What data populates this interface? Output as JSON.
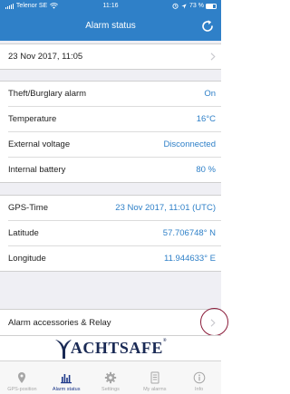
{
  "status_bar": {
    "carrier": "Telenor SE",
    "time": "11:16",
    "battery": "73 %",
    "battery_level": 0.73
  },
  "nav": {
    "title": "Alarm status",
    "refresh_icon": "refresh-icon"
  },
  "timestamp_row": {
    "label": "23 Nov 2017, 11:05",
    "chevron": "chevron-right-icon"
  },
  "status_rows": [
    {
      "label": "Theft/Burglary alarm",
      "value": "On"
    },
    {
      "label": "Temperature",
      "value": "16°C"
    },
    {
      "label": "External voltage",
      "value": "Disconnected"
    },
    {
      "label": "Internal battery",
      "value": "80 %"
    }
  ],
  "gps_rows": [
    {
      "label": "GPS-Time",
      "value": "23 Nov 2017, 11:01 (UTC)"
    },
    {
      "label": "Latitude",
      "value": "57.706748° N"
    },
    {
      "label": "Longitude",
      "value": "11.944633° E"
    }
  ],
  "accessories_row": {
    "label": "Alarm accessories & Relay",
    "chevron": "chevron-right-icon"
  },
  "logo": {
    "letter": "Y",
    "text": "ACHTSAFE",
    "mark": "®"
  },
  "tabs": [
    {
      "label": "GPS-position",
      "icon": "location-pin-icon",
      "active": false
    },
    {
      "label": "Alarm status",
      "icon": "bar-chart-icon",
      "active": true
    },
    {
      "label": "Settings",
      "icon": "gear-icon",
      "active": false
    },
    {
      "label": "My alarms",
      "icon": "document-list-icon",
      "active": false
    },
    {
      "label": "Info",
      "icon": "info-icon",
      "active": false
    }
  ],
  "colors": {
    "primary": "#2f80c8",
    "value_text": "#2f80c8",
    "section_bg": "#efeff4",
    "tab_active": "#1f3a8a",
    "tab_inactive": "#a6a6a6",
    "highlight_ring": "#8b1c3a"
  }
}
